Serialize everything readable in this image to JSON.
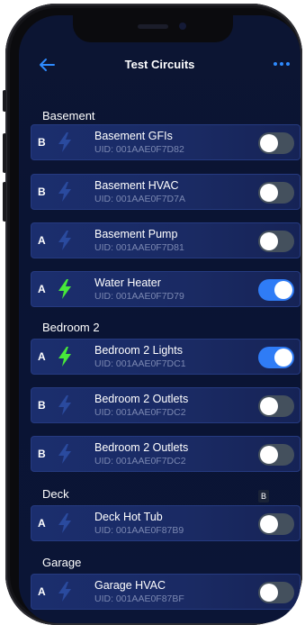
{
  "header": {
    "title": "Test Circuits"
  },
  "accent": "#2e8bff",
  "sections": [
    {
      "label": "Basement",
      "items": [
        {
          "phase": "B",
          "name": "Basement GFIs",
          "uid": "UID: 001AAE0F7D82",
          "on": false
        },
        {
          "phase": "B",
          "name": "Basement HVAC",
          "uid": "UID: 001AAE0F7D7A",
          "on": false
        },
        {
          "phase": "A",
          "name": "Basement Pump",
          "uid": "UID: 001AAE0F7D81",
          "on": false
        },
        {
          "phase": "A",
          "name": "Water Heater",
          "uid": "UID: 001AAE0F7D79",
          "on": true
        }
      ]
    },
    {
      "label": "Bedroom 2",
      "items": [
        {
          "phase": "A",
          "name": "Bedroom 2 Lights",
          "uid": "UID: 001AAE0F7DC1",
          "on": true
        },
        {
          "phase": "B",
          "name": "Bedroom 2 Outlets",
          "uid": "UID: 001AAE0F7DC2",
          "on": false
        },
        {
          "phase": "B",
          "name": "Bedroom 2 Outlets",
          "uid": "UID: 001AAE0F7DC2",
          "on": false
        }
      ]
    },
    {
      "label": "Deck",
      "items": [
        {
          "phase": "A",
          "name": "Deck Hot Tub",
          "uid": "UID: 001AAE0F87B9",
          "on": false
        }
      ]
    },
    {
      "label": "Garage",
      "items": [
        {
          "phase": "A",
          "name": "Garage HVAC",
          "uid": "UID: 001AAE0F87BF",
          "on": false
        }
      ]
    }
  ],
  "tooltip": "B"
}
